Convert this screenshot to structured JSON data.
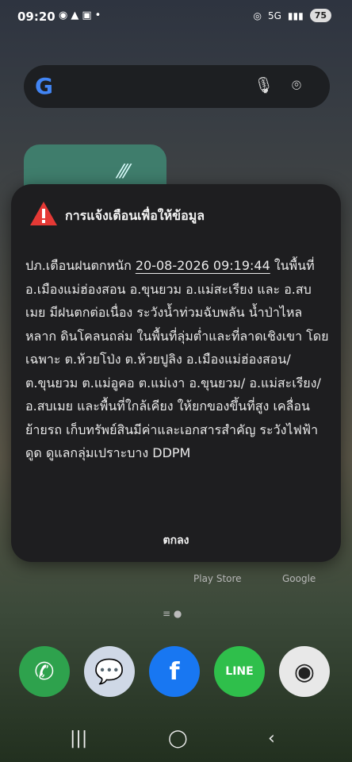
{
  "status_bar": {
    "time": "09:20",
    "icons_left": [
      "line-icon",
      "warning-icon",
      "gallery-icon",
      "dot"
    ],
    "signal_label": "5G",
    "battery": "75"
  },
  "search_bar": {
    "logo": "G"
  },
  "alert": {
    "title": "การแจ้งเตือนเพื่อให้ข้อมูล",
    "body_prefix": "ปภ.เตือนฝนตกหนัก ",
    "timestamp": "20-08-2026 09:19:44",
    "body_rest": " ในพื้นที่ อ.เมืองแม่ฮ่องสอน อ.ขุนยวม อ.แม่สะเรียง และ อ.สบเมย มีฝนตกต่อเนื่อง ระวังน้ำท่วมฉับพลัน น้ำป่าไหลหลาก ดินโคลนถล่ม ในพื้นที่ลุ่มต่ำและที่ลาดเชิงเขา โดยเฉพาะ ต.ห้วยโป่ง ต.ห้วยปูลิง อ.เมืองแม่ฮ่องสอน/ ต.ขุนยวม ต.แม่อูคอ ต.แม่เงา อ.ขุนยวม/ อ.แม่สะเรียง/ อ.สบเมย และพื้นที่ใกล้เคียง ให้ยกของขึ้นที่สูง เคลื่อนย้ายรถ เก็บทรัพย์สินมีค่าและเอกสารสำคัญ ระวังไฟฟ้าดูด ดูแลกลุ่มเปราะบาง DDPM",
    "ok_label": "ตกลง"
  },
  "home_labels": {
    "play_store": "Play Store",
    "google": "Google"
  },
  "colors": {
    "dialog_bg": "#1e1e20",
    "warning_red": "#e53935"
  }
}
